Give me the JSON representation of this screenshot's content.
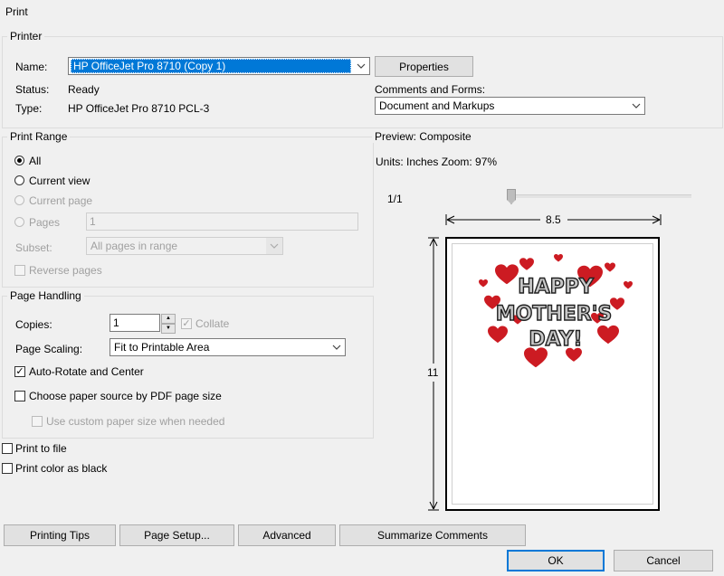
{
  "window": {
    "title": "Print"
  },
  "printer": {
    "legend": "Printer",
    "name_label": "Name:",
    "name_value": "HP OfficeJet Pro 8710 (Copy 1)",
    "status_label": "Status:",
    "status_value": "Ready",
    "type_label": "Type:",
    "type_value": "HP OfficeJet Pro 8710 PCL-3",
    "properties_button": "Properties",
    "comments_label": "Comments and Forms:",
    "comments_value": "Document and Markups"
  },
  "print_range": {
    "legend": "Print Range",
    "all": "All",
    "current_view": "Current view",
    "current_page": "Current page",
    "pages": "Pages",
    "pages_value": "1",
    "subset_label": "Subset:",
    "subset_value": "All pages in range",
    "reverse_pages": "Reverse pages",
    "selected": "All"
  },
  "page_handling": {
    "legend": "Page Handling",
    "copies_label": "Copies:",
    "copies_value": "1",
    "collate": "Collate",
    "scaling_label": "Page Scaling:",
    "scaling_value": "Fit to Printable Area",
    "auto_rotate": "Auto-Rotate and Center",
    "choose_paper": "Choose paper source by PDF page size",
    "custom_paper": "Use custom paper size when needed"
  },
  "options": {
    "print_to_file": "Print to file",
    "print_color_black": "Print color as black"
  },
  "preview": {
    "legend": "Preview: Composite",
    "units": "Units: Inches Zoom:  97%",
    "page_counter": "1/1",
    "width": "8.5",
    "height": "11",
    "artwork_words": [
      "HAPPY",
      "MOTHER'S",
      "DAY!"
    ]
  },
  "buttons": {
    "printing_tips": "Printing Tips",
    "page_setup": "Page Setup...",
    "advanced": "Advanced",
    "summarize": "Summarize Comments",
    "ok": "OK",
    "cancel": "Cancel"
  },
  "colors": {
    "accent": "#0078d7",
    "heart": "#cc1b22"
  }
}
